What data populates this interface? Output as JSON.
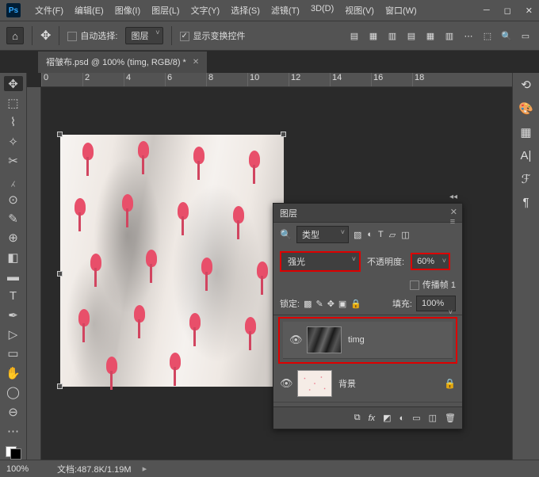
{
  "menu": {
    "file": "文件(F)",
    "edit": "编辑(E)",
    "image": "图像(I)",
    "layer": "图层(L)",
    "type": "文字(Y)",
    "select": "选择(S)",
    "filter": "滤镜(T)",
    "threed": "3D(D)",
    "view": "视图(V)",
    "window": "窗口(W)"
  },
  "logo": "Ps",
  "options": {
    "autoselect": "自动选择:",
    "target": "图层",
    "showtransform": "显示变换控件"
  },
  "doctab": {
    "title": "褶皱布.psd @ 100% (timg, RGB/8) *"
  },
  "ruler": {
    "marks": [
      "0",
      "2",
      "4",
      "6",
      "8",
      "10",
      "12",
      "14",
      "16",
      "18"
    ]
  },
  "layerspanel": {
    "title": "图层",
    "filter": "类型",
    "blendlabel": "",
    "blendmode": "强光",
    "opacitylabel": "不透明度:",
    "opacity": "60%",
    "propagate": "传播帧 1",
    "locklabel": "锁定:",
    "filllabel": "填充:",
    "fill": "100%",
    "layers": [
      {
        "name": "timg",
        "visible": true,
        "selected": true,
        "thumb": "fabric"
      },
      {
        "name": "背景",
        "visible": true,
        "selected": false,
        "thumb": "bg",
        "locked": true
      }
    ]
  },
  "status": {
    "zoom": "100%",
    "docinfo": "文档:487.8K/1.19M"
  }
}
